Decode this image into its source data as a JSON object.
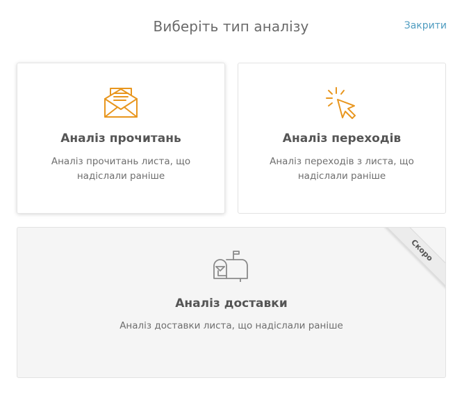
{
  "modal": {
    "title": "Виберіть тип аналізу",
    "close_label": "Закрити"
  },
  "cards": {
    "opens": {
      "title": "Аналіз прочитань",
      "description": "Аналіз прочитань листа, що надіслали раніше",
      "icon": "open-envelope-icon"
    },
    "clicks": {
      "title": "Аналіз переходів",
      "description": "Аналіз переходів з листа, що надіслали раніше",
      "icon": "cursor-click-icon"
    },
    "delivery": {
      "title": "Аналіз доставки",
      "description": "Аналіз доставки листа, що надіслали раніше",
      "icon": "mailbox-icon",
      "badge": "Скоро"
    }
  },
  "colors": {
    "accent_orange": "#e8961e",
    "link_blue": "#4f9cc0",
    "disabled_gray": "#8a8a8a"
  }
}
